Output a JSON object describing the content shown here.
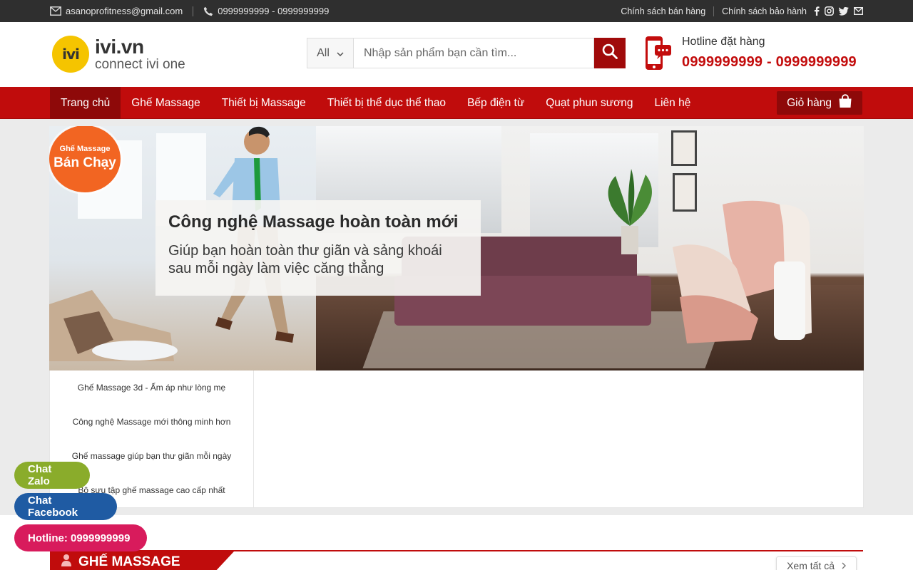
{
  "topbar": {
    "email": "asanoprofitness@gmail.com",
    "phone": "0999999999 - 0999999999",
    "links": [
      "Chính sách bán hàng",
      "Chính sách bảo hành"
    ]
  },
  "header": {
    "logo_mark": "ivi",
    "logo_name": "ivi.vn",
    "logo_tagline": "connect ivi one",
    "search_category": "All",
    "search_placeholder": "Nhập sản phẩm bạn cần tìm...",
    "hotline_label": "Hotline đặt hàng",
    "hotline_number": "0999999999 - 0999999999"
  },
  "nav": {
    "items": [
      "Trang chủ",
      "Ghế Massage",
      "Thiết bị Massage",
      "Thiết bị thể dục thể thao",
      "Bếp điện từ",
      "Quạt phun sương",
      "Liên hệ"
    ],
    "cart_label": "Giỏ hàng"
  },
  "hero": {
    "badge_line1": "Ghế Massage",
    "badge_line2": "Bán Chạy",
    "title": "Công nghệ Massage hoàn toàn mới",
    "subtitle_line1": "Giúp bạn hoàn toàn thư giãn và sảng khoái",
    "subtitle_line2": "sau mỗi ngày làm việc căng thẳng"
  },
  "slider_tabs": [
    "Ghế Massage 3d - Ấm áp như lòng mẹ",
    "Công nghệ Massage mới thông minh hơn",
    "Ghế massage giúp bạn thư giãn mỗi ngày",
    "Bộ sưu tập ghế massage cao cấp nhất"
  ],
  "section": {
    "title": "GHẾ MASSAGE",
    "see_all": "Xem tất cả"
  },
  "floating": {
    "zalo": "Chat Zalo",
    "facebook": "Chat Facebook",
    "hotline": "Hotline: 0999999999"
  },
  "colors": {
    "brand_red": "#c00c0c",
    "dark_red": "#8e0909",
    "topbar_bg": "#2f2f2f",
    "badge_orange": "#f26522",
    "zalo_green": "#8aac2b",
    "facebook_blue": "#1f5ba3",
    "hotline_pink": "#d81b5c"
  }
}
